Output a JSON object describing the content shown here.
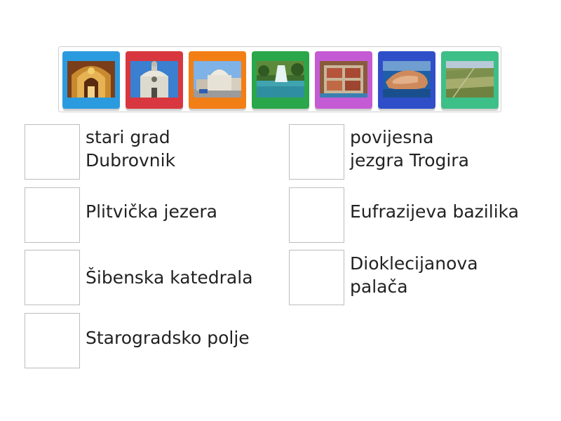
{
  "tiles": [
    {
      "name": "tile-euphrasian-basilica-image",
      "color": "#2b9be0",
      "icon": "basilica-interior-photo"
    },
    {
      "name": "tile-sibenik-cathedral-image",
      "color": "#d8373f",
      "icon": "cathedral-facade-photo"
    },
    {
      "name": "tile-trogir-image",
      "color": "#f27e16",
      "icon": "town-square-photo"
    },
    {
      "name": "tile-plitvice-image",
      "color": "#2aa74a",
      "icon": "waterfall-lake-photo"
    },
    {
      "name": "tile-diocletian-palace-image",
      "color": "#c55bd4",
      "icon": "palace-aerial-photo"
    },
    {
      "name": "tile-dubrovnik-image",
      "color": "#2f4fc9",
      "icon": "walled-city-photo"
    },
    {
      "name": "tile-stari-grad-plain-image",
      "color": "#3dbf88",
      "icon": "fields-aerial-photo"
    }
  ],
  "labels": {
    "dubrovnik": "stari grad\nDubrovnik",
    "trogir": "povijesna\n jezgra Trogira",
    "plitvice": "Plitvička jezera",
    "euphrasian": "Eufrazijeva bazilika",
    "sibenik": "Šibenska katedrala",
    "diocletian": "Dioklecijanova\npalača",
    "starigrad": "Starogradsko polje"
  }
}
